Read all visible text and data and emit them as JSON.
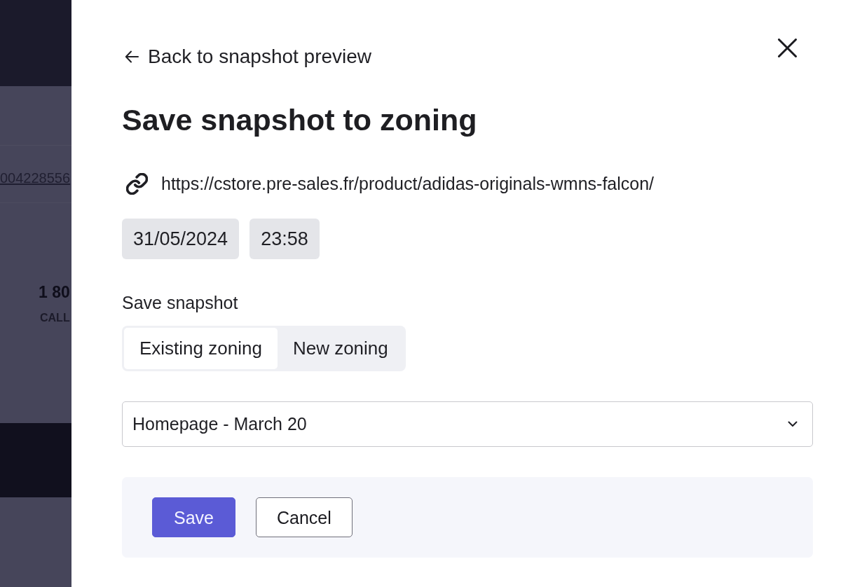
{
  "background_page": {
    "link": "004228556",
    "stat": {
      "value": "1 80",
      "label": "CALL"
    }
  },
  "panel": {
    "back_link": "Back to snapshot preview",
    "title": "Save snapshot to zoning",
    "url": "https://cstore.pre-sales.fr/product/adidas-originals-wmns-falcon/",
    "date_chips": [
      "31/05/2024",
      "23:58"
    ],
    "save_mode": {
      "label": "Save snapshot",
      "options": [
        {
          "label": "Existing zoning",
          "selected": true
        },
        {
          "label": "New zoning",
          "selected": false
        }
      ]
    },
    "zoning_select": {
      "value": "Homepage - March 20"
    },
    "buttons": [
      {
        "label": "Save",
        "kind": "primary"
      },
      {
        "label": "Cancel",
        "kind": "secondary"
      }
    ]
  }
}
